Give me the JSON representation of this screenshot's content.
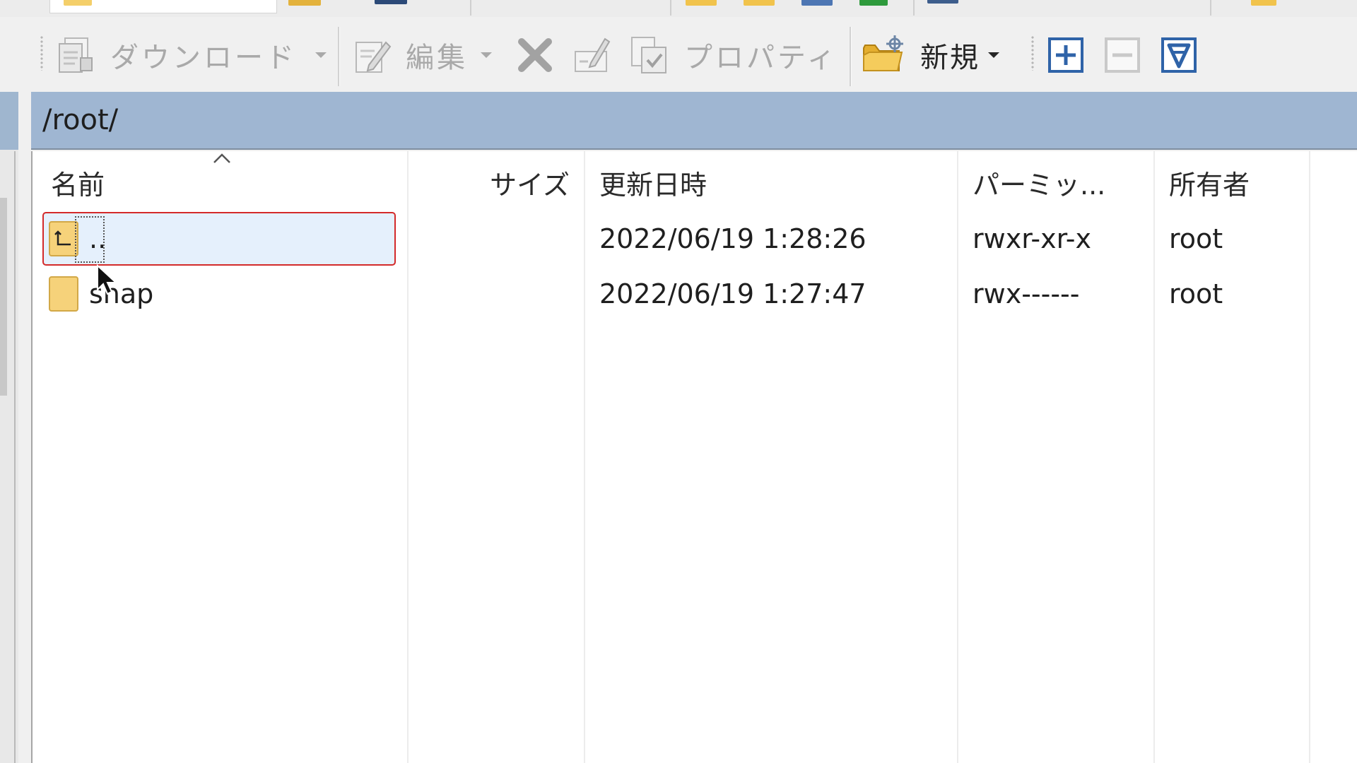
{
  "toolbar": {
    "download_label": "ダウンロード",
    "edit_label": "編集",
    "properties_label": "プロパティ",
    "new_label": "新規"
  },
  "path_bar": {
    "path": "/root/"
  },
  "columns": {
    "name": "名前",
    "size": "サイズ",
    "modified": "更新日時",
    "permissions": "パーミッ...",
    "owner": "所有者"
  },
  "files": [
    {
      "name": "..",
      "size": "",
      "modified": "2022/06/19 1:28:26",
      "permissions": "rwxr-xr-x",
      "owner": "root"
    },
    {
      "name": "snap",
      "size": "",
      "modified": "2022/06/19 1:27:47",
      "permissions": "rwx------",
      "owner": "root"
    }
  ],
  "colors": {
    "path_bar": "#9fb6d2",
    "selection_fill": "#e5f0fc",
    "selection_border": "#d32a2a",
    "folder": "#f6d27a"
  }
}
